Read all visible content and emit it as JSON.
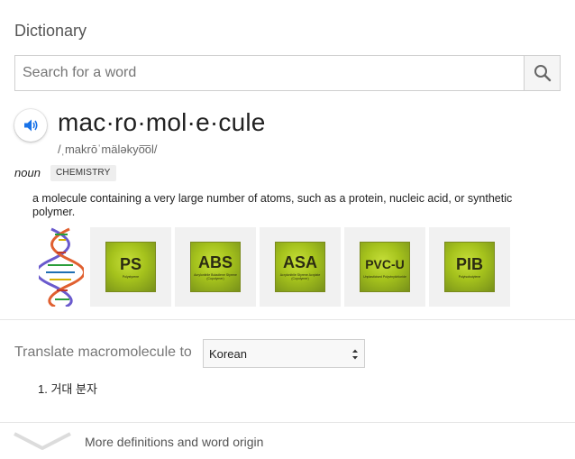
{
  "dictionary": {
    "title": "Dictionary",
    "search": {
      "placeholder": "Search for a word",
      "value": "",
      "icon": "search-icon"
    },
    "entry": {
      "headword": "mac·ro·mol·e·cule",
      "pronunciation": "/ˌmakrōˈmäləkyo͞ol/",
      "part_of_speech": "noun",
      "domain": "CHEMISTRY",
      "definition": "a molecule containing a very large number of atoms, such as a protein, nucleic acid, or synthetic polymer.",
      "audio_icon": "speaker-icon"
    },
    "images": [
      {
        "name": "dna-double-helix"
      },
      {
        "abbr": "PS",
        "sub": "Polystyrene"
      },
      {
        "abbr": "ABS",
        "sub": "Acrylonitrile Butadiene Styrene (Copolymer)"
      },
      {
        "abbr": "ASA",
        "sub": "Acrylonitrile Styrene Acrylate (Copolymer)"
      },
      {
        "abbr": "PVC-U",
        "sub": "Unplasticised Polyvinylchloride"
      },
      {
        "abbr": "PIB",
        "sub": "Polyisobutylene"
      }
    ],
    "translate": {
      "label": "Translate macromolecule to",
      "language": "Korean",
      "results": [
        "1. 거대 분자"
      ]
    },
    "more": {
      "label": "More definitions and word origin",
      "icon": "chevron-down-icon"
    }
  }
}
